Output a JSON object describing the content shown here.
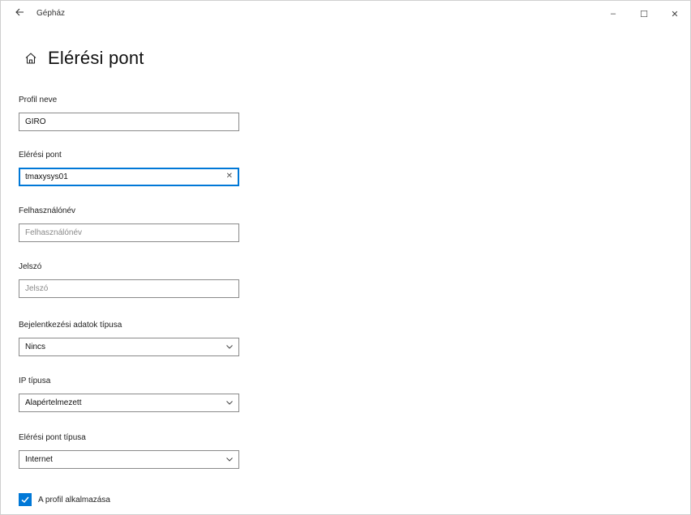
{
  "window": {
    "title": "Gépház",
    "controls": {
      "minimize": "–",
      "maximize": "☐",
      "close": "✕"
    }
  },
  "page": {
    "title": "Elérési pont",
    "icon": "home-icon"
  },
  "form": {
    "profile_name": {
      "label": "Profil neve",
      "value": "GIRO"
    },
    "access_point": {
      "label": "Elérési pont",
      "value": "tmaxysys01",
      "clear": "✕"
    },
    "username": {
      "label": "Felhasználónév",
      "placeholder": "Felhasználónév"
    },
    "password": {
      "label": "Jelszó",
      "placeholder": "Jelszó"
    },
    "auth_type": {
      "label": "Bejelentkezési adatok típusa",
      "value": "Nincs"
    },
    "ip_type": {
      "label": "IP típusa",
      "value": "Alapértelmezett"
    },
    "ap_type": {
      "label": "Elérési pont típusa",
      "value": "Internet"
    },
    "apply_profile": {
      "label": "A profil alkalmazása",
      "checked": true
    }
  },
  "colors": {
    "accent": "#0078d7",
    "border": "#8a8a8a"
  }
}
